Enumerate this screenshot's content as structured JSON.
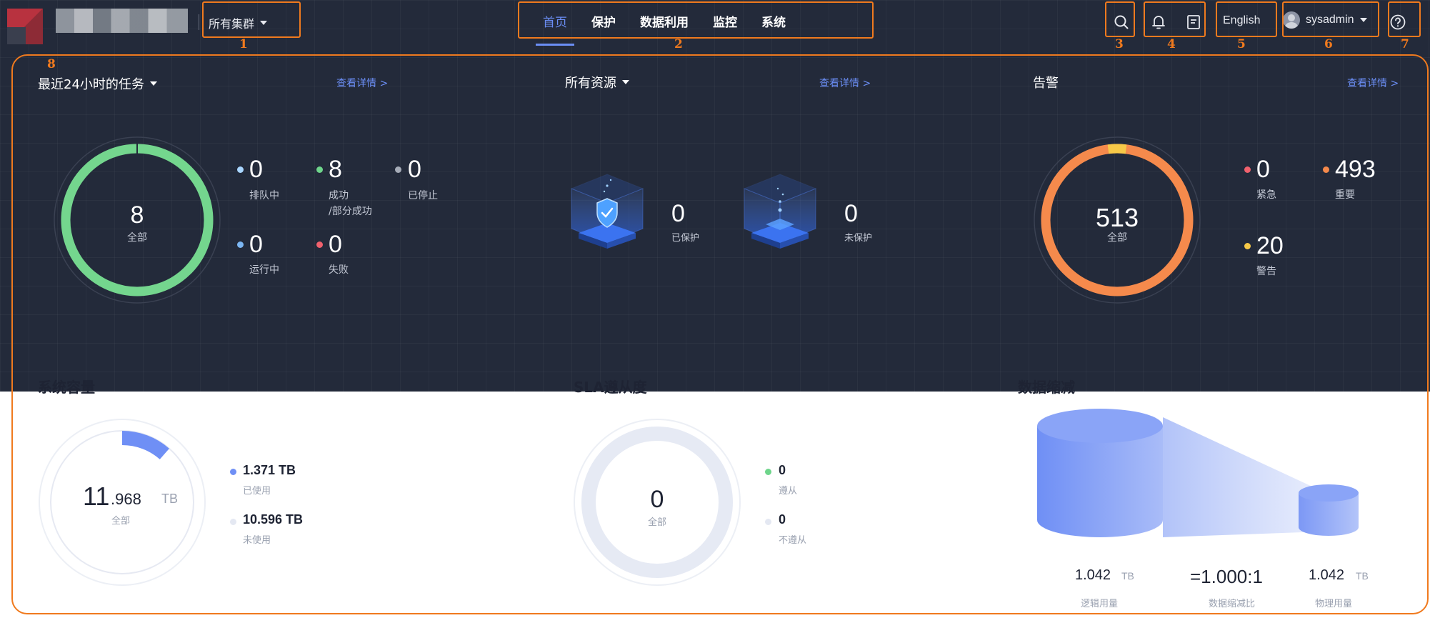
{
  "header": {
    "cluster_label": "所有集群",
    "nav": [
      "首页",
      "保护",
      "数据利用",
      "监控",
      "系统"
    ],
    "language": "English",
    "username": "sysadmin",
    "icons": [
      "search-icon",
      "bell-icon",
      "task-list-icon",
      "user-avatar-icon",
      "help-icon"
    ]
  },
  "annotations": [
    "1",
    "2",
    "3",
    "4",
    "5",
    "6",
    "7",
    "8"
  ],
  "tasks_panel": {
    "title": "最近24小时的任务",
    "detail_link": "查看详情 >",
    "total": "8",
    "total_label": "全部",
    "stats": [
      {
        "value": "0",
        "label": "排队中",
        "color": "#a9d6ff"
      },
      {
        "value": "8",
        "label": "成功",
        "label2": "/部分成功",
        "color": "#6ed58b"
      },
      {
        "value": "0",
        "label": "已停止",
        "color": "#a6acb8"
      },
      {
        "value": "0",
        "label": "运行中",
        "color": "#7cb6f2"
      },
      {
        "value": "0",
        "label": "失败",
        "color": "#f0616d"
      }
    ],
    "ring_color": "#74d68e"
  },
  "resources_panel": {
    "title": "所有资源",
    "detail_link": "查看详情 >",
    "protected_value": "0",
    "protected_label": "已保护",
    "unprotected_value": "0",
    "unprotected_label": "未保护"
  },
  "alarms_panel": {
    "title": "告警",
    "detail_link": "查看详情 >",
    "total": "513",
    "total_label": "全部",
    "stats": [
      {
        "value": "0",
        "label": "紧急",
        "color": "#f0616d"
      },
      {
        "value": "493",
        "label": "重要",
        "color": "#f5894b"
      },
      {
        "value": "20",
        "label": "警告",
        "color": "#f7c948"
      }
    ],
    "ring_color": "#f58a4c",
    "warning_color": "#f7c948"
  },
  "capacity_panel": {
    "title": "系统容量",
    "total_int": "11",
    "total_dec": ".968",
    "total_unit": "TB",
    "total_label": "全部",
    "used_value": "1.371 TB",
    "used_label": "已使用",
    "used_fraction": 0.1146,
    "unused_value": "10.596 TB",
    "unused_label": "未使用",
    "used_color": "#6f8ff5",
    "unused_color": "#e4e8f2"
  },
  "sla_panel": {
    "title": "SLA遵从度",
    "total": "0",
    "total_label": "全部",
    "compliant_value": "0",
    "compliant_label": "遵从",
    "noncompliant_value": "0",
    "noncompliant_label": "不遵从",
    "compliant_color": "#6ed58b",
    "noncompliant_color": "#e4e8f2"
  },
  "reduction_panel": {
    "title": "数据缩减",
    "logical_value": "1.042",
    "logical_unit": "TB",
    "logical_label": "逻辑用量",
    "ratio_value": "=1.000:1",
    "ratio_label": "数据缩减比",
    "physical_value": "1.042",
    "physical_unit": "TB",
    "physical_label": "物理用量"
  }
}
